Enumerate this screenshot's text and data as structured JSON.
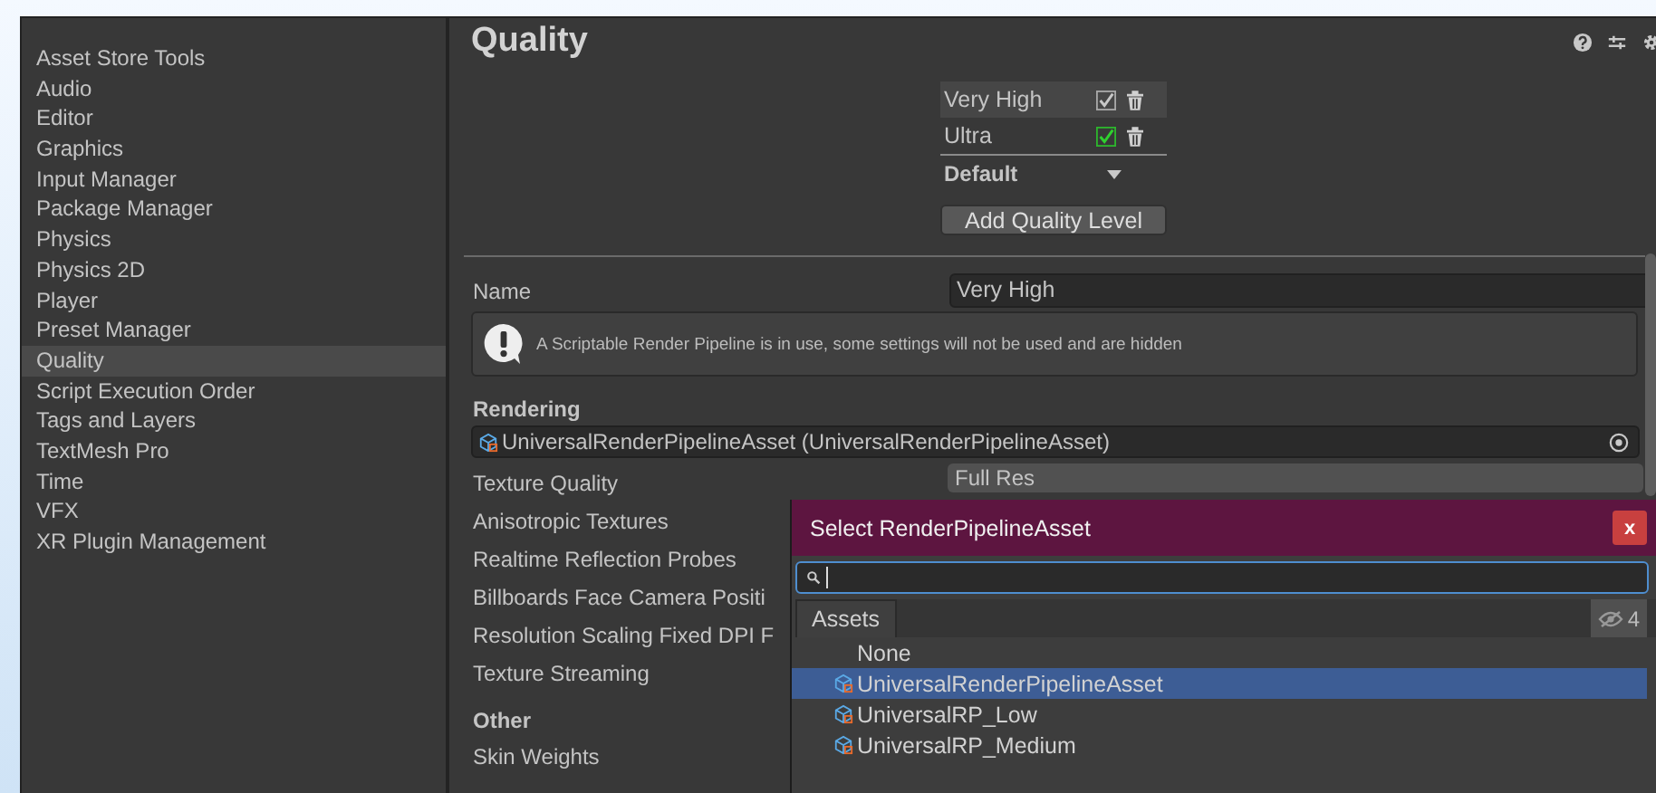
{
  "sidebar": {
    "items": [
      {
        "label": "Asset Store Tools",
        "selected": false
      },
      {
        "label": "Audio",
        "selected": false
      },
      {
        "label": "Editor",
        "selected": false
      },
      {
        "label": "Graphics",
        "selected": false
      },
      {
        "label": "Input Manager",
        "selected": false
      },
      {
        "label": "Package Manager",
        "selected": false
      },
      {
        "label": "Physics",
        "selected": false
      },
      {
        "label": "Physics 2D",
        "selected": false
      },
      {
        "label": "Player",
        "selected": false
      },
      {
        "label": "Preset Manager",
        "selected": false
      },
      {
        "label": "Quality",
        "selected": true
      },
      {
        "label": "Script Execution Order",
        "selected": false
      },
      {
        "label": "Tags and Layers",
        "selected": false
      },
      {
        "label": "TextMesh Pro",
        "selected": false
      },
      {
        "label": "Time",
        "selected": false
      },
      {
        "label": "VFX",
        "selected": false
      },
      {
        "label": "XR Plugin Management",
        "selected": false
      }
    ]
  },
  "panel": {
    "title": "Quality",
    "levels": [
      {
        "name": "Very High",
        "selected": true,
        "checked": true,
        "platform_default": false
      },
      {
        "name": "Ultra",
        "selected": false,
        "checked": true,
        "platform_default": true
      }
    ],
    "default_label": "Default",
    "add_button": "Add Quality Level",
    "name_label": "Name",
    "name_value": "Very High",
    "help_text": "A Scriptable Render Pipeline is in use, some settings will not be used and are hidden",
    "rendering_header": "Rendering",
    "pipeline_asset": "UniversalRenderPipelineAsset (UniversalRenderPipelineAsset)",
    "settings": [
      {
        "label": "Texture Quality",
        "value": "Full Res"
      },
      {
        "label": "Anisotropic Textures"
      },
      {
        "label": "Realtime Reflection Probes"
      },
      {
        "label": "Billboards Face Camera Positi"
      },
      {
        "label": "Resolution Scaling Fixed DPI F"
      },
      {
        "label": "Texture Streaming"
      }
    ],
    "other_header": "Other",
    "other_settings": [
      {
        "label": "Skin Weights"
      }
    ]
  },
  "picker": {
    "title": "Select RenderPipelineAsset",
    "close": "x",
    "tab": "Assets",
    "hidden_count": "4",
    "items": [
      {
        "label": "None",
        "kind": "none",
        "selected": false
      },
      {
        "label": "UniversalRenderPipelineAsset",
        "kind": "asset",
        "selected": true
      },
      {
        "label": "UniversalRP_Low",
        "kind": "asset",
        "selected": false
      },
      {
        "label": "UniversalRP_Medium",
        "kind": "asset",
        "selected": false
      }
    ]
  }
}
